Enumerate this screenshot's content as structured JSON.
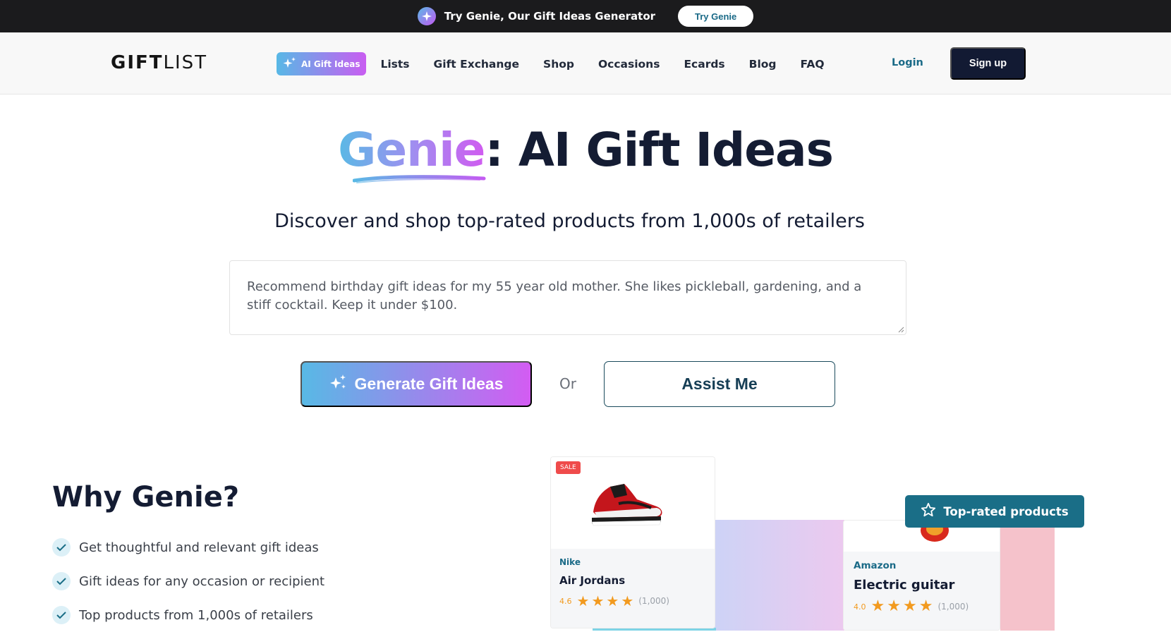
{
  "promo": {
    "text": "Try Genie, Our Gift Ideas Generator",
    "button": "Try Genie",
    "icon": "sparkle-icon"
  },
  "nav": {
    "logo_bold": "GIFT",
    "logo_light": "LIST",
    "ai_pill": "AI Gift Ideas",
    "links": [
      "Lists",
      "Gift Exchange",
      "Shop",
      "Occasions",
      "Ecards",
      "Blog",
      "FAQ"
    ],
    "login": "Login",
    "signup": "Sign up"
  },
  "hero": {
    "title_highlight": "Genie",
    "title_rest": ": AI Gift Ideas",
    "subtitle": "Discover and shop top-rated products from 1,000s of retailers",
    "prompt_value": "Recommend birthday gift ideas for my 55 year old mother. She likes pickleball, gardening, and a stiff cocktail. Keep it under $100.",
    "generate_label": "Generate Gift Ideas",
    "or_label": "Or",
    "assist_label": "Assist Me"
  },
  "why": {
    "title": "Why Genie?",
    "items": [
      "Get thoughtful and relevant gift ideas",
      "Gift ideas for any occasion or recipient",
      "Top products from 1,000s of retailers"
    ]
  },
  "products": [
    {
      "badge": "SALE",
      "brand": "Nike",
      "name": "Air Jordans",
      "rating": "4.6",
      "stars": 4,
      "count": "(1,000)"
    },
    {
      "brand": "Amazon",
      "name": "Electric guitar",
      "rating": "4.0",
      "stars": 4,
      "count": "(1,000)"
    }
  ],
  "top_rated_label": "Top-rated products",
  "colors": {
    "brand_teal": "#1a6e87",
    "navy": "#121a33",
    "gradient_start": "#58b9e5",
    "gradient_end": "#d35cf2",
    "star": "#f29a1f",
    "sale": "#ef4b4b"
  }
}
